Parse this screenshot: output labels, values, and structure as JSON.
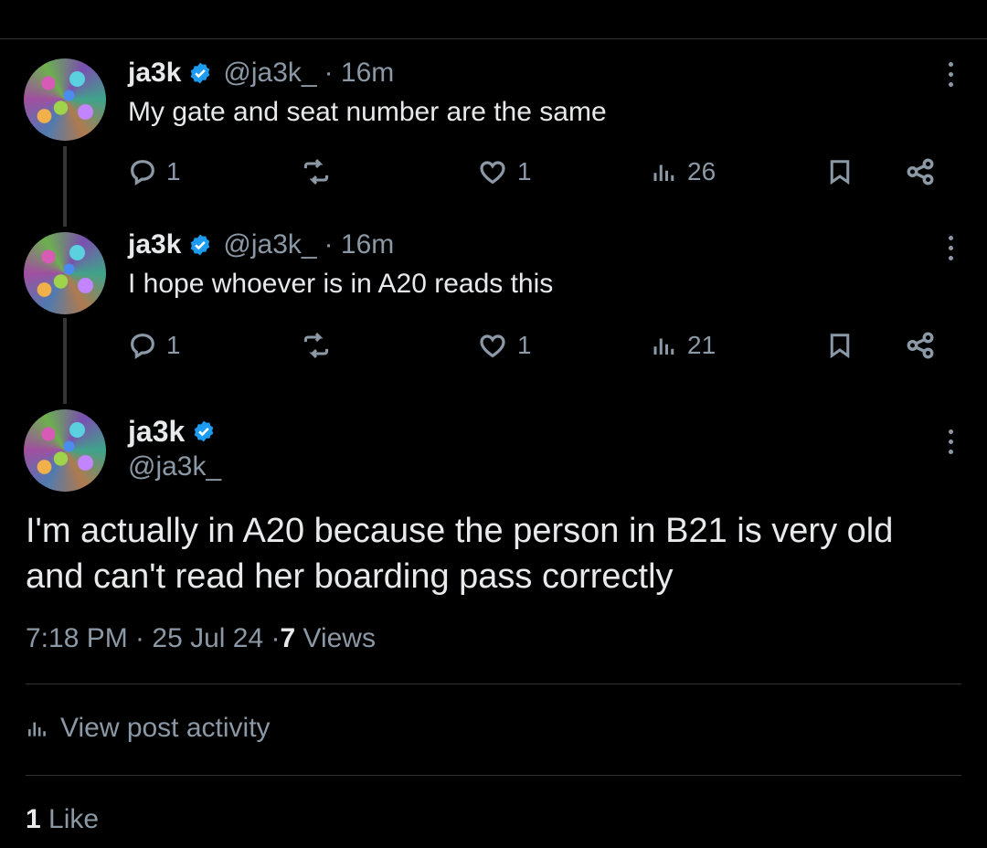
{
  "colors": {
    "background": "#000000",
    "text": "#e7e9ea",
    "muted": "#8b98a5",
    "verified": "#1d9bf0"
  },
  "tweets": [
    {
      "name": "ja3k",
      "handle": "@ja3k_",
      "time": "· 16m",
      "text": "My gate and seat number are the same",
      "replies": "1",
      "likes": "1",
      "views": "26"
    },
    {
      "name": "ja3k",
      "handle": "@ja3k_",
      "time": "· 16m",
      "text": "I hope whoever is in A20 reads this",
      "replies": "1",
      "likes": "1",
      "views": "21"
    }
  ],
  "main_tweet": {
    "name": "ja3k",
    "handle": "@ja3k_",
    "text": "I'm actually in A20 because the person in B21 is very old and can't read her boarding pass correctly",
    "timestamp": "7:18 PM · 25 Jul 24 · ",
    "views_count": "7",
    "views_label": " Views",
    "activity_label": "View post activity",
    "likes_count": "1",
    "likes_label": " Like"
  },
  "icons": [
    "verified-icon",
    "more-icon",
    "reply-icon",
    "retweet-icon",
    "like-icon",
    "views-icon",
    "bookmark-icon",
    "share-icon"
  ]
}
